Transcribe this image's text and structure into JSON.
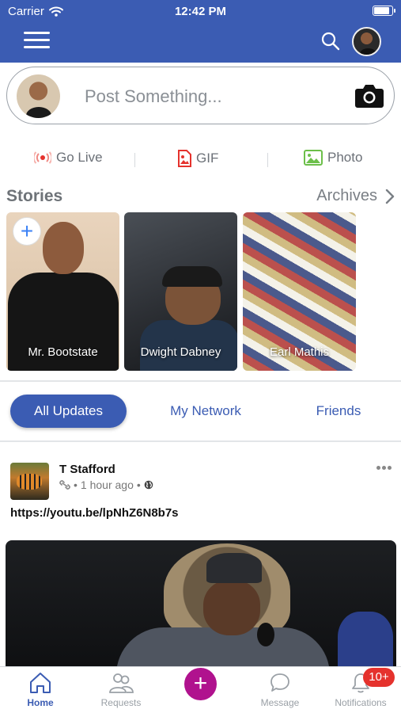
{
  "status_bar": {
    "carrier": "Carrier",
    "time": "12:42 PM"
  },
  "composer": {
    "placeholder": "Post Something..."
  },
  "actions": {
    "live": "Go Live",
    "gif": "GIF",
    "photo": "Photo"
  },
  "stories": {
    "title": "Stories",
    "archives_label": "Archives",
    "items": [
      {
        "name": "Mr. Bootstate"
      },
      {
        "name": "Dwight Dabney"
      },
      {
        "name": "Earl Mathis"
      }
    ]
  },
  "tabs": {
    "all": "All Updates",
    "network": "My Network",
    "friends": "Friends"
  },
  "post": {
    "author": "T Stafford",
    "time": "1 hour ago",
    "link": "https://youtu.be/lpNhZ6N8b7s"
  },
  "bottom_nav": {
    "home": "Home",
    "requests": "Requests",
    "message": "Message",
    "notifications": "Notifications",
    "notifications_badge": "10+"
  },
  "colors": {
    "brand": "#3b5cb3",
    "fab": "#b0128e",
    "badge": "#e5322d"
  }
}
